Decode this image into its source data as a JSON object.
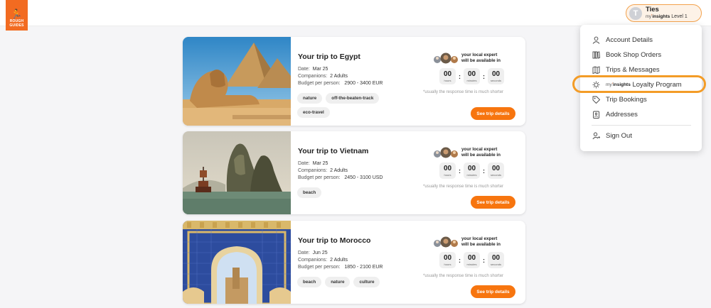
{
  "brand": {
    "logo_line1": "ROUGH",
    "logo_line2": "GUIDES"
  },
  "user": {
    "initial": "T",
    "name": "Ties",
    "level_my": "my",
    "level_insights": "insights",
    "level_label": "Level 1"
  },
  "trips": [
    {
      "title": "Your trip to Egypt",
      "date_label": "Date:",
      "date": "Mar 25",
      "companions_label": "Companions:",
      "companions": "2 Adults",
      "budget_label": "Budget per person:",
      "budget": "2900 - 3400 EUR",
      "tags": [
        "nature",
        "off-the-beaten-track",
        "eco-travel"
      ]
    },
    {
      "title": "Your trip to Vietnam",
      "date_label": "Date:",
      "date": "Mar 25",
      "companions_label": "Companions:",
      "companions": "2 Adults",
      "budget_label": "Budget per person:",
      "budget": "2450 - 3100 USD",
      "tags": [
        "beach"
      ]
    },
    {
      "title": "Your trip to Morocco",
      "date_label": "Date:",
      "date": "Jun 25",
      "companions_label": "Companions:",
      "companions": "2 Adults",
      "budget_label": "Budget per person:",
      "budget": "1850 - 2100 EUR",
      "tags": [
        "beach",
        "nature",
        "culture"
      ]
    }
  ],
  "expert": {
    "line1": "your local expert",
    "line2": "will be available in",
    "hours_value": "00",
    "hours_label": "hours",
    "minutes_value": "00",
    "minutes_label": "minutes",
    "seconds_value": "00",
    "seconds_label": "seconds",
    "separator": ":",
    "note": "*usually the response time is much shorter",
    "button": "See trip details"
  },
  "menu": {
    "account": "Account Details",
    "orders": "Book Shop Orders",
    "trips": "Trips & Messages",
    "loyalty_my": "my",
    "loyalty_insights": "insights",
    "loyalty_label": "Loyalty Program",
    "bookings": "Trip Bookings",
    "addresses": "Addresses",
    "signout": "Sign Out"
  },
  "colors": {
    "accent": "#f26b21",
    "button": "#f7750f",
    "highlight": "#f39c27"
  }
}
